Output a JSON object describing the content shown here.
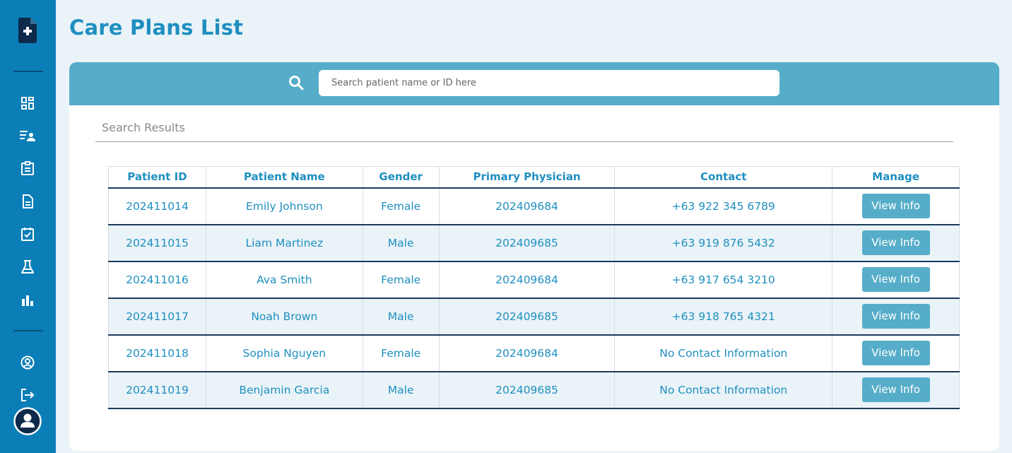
{
  "page": {
    "title": "Care Plans List"
  },
  "search": {
    "placeholder": "Search patient name or ID here",
    "results_label": "Search Results"
  },
  "table": {
    "headers": [
      "Patient ID",
      "Patient Name",
      "Gender",
      "Primary Physician",
      "Contact",
      "Manage"
    ],
    "rows": [
      {
        "id": "202411014",
        "name": "Emily Johnson",
        "gender": "Female",
        "physician": "202409684",
        "contact": "+63 922 345 6789",
        "action": "View Info"
      },
      {
        "id": "202411015",
        "name": "Liam Martinez",
        "gender": "Male",
        "physician": "202409685",
        "contact": "+63 919 876 5432",
        "action": "View Info"
      },
      {
        "id": "202411016",
        "name": "Ava Smith",
        "gender": "Female",
        "physician": "202409684",
        "contact": "+63 917 654 3210",
        "action": "View Info"
      },
      {
        "id": "202411017",
        "name": "Noah Brown",
        "gender": "Male",
        "physician": "202409685",
        "contact": "+63 918 765 4321",
        "action": "View Info"
      },
      {
        "id": "202411018",
        "name": "Sophia Nguyen",
        "gender": "Female",
        "physician": "202409684",
        "contact": "No Contact Information",
        "action": "View Info"
      },
      {
        "id": "202411019",
        "name": "Benjamin Garcia",
        "gender": "Male",
        "physician": "202409685",
        "contact": "No Contact Information",
        "action": "View Info"
      }
    ]
  },
  "sidebar": {
    "icons": [
      "medical-file-plus-icon",
      "dashboard-grid-icon",
      "patient-list-icon",
      "clipboard-icon",
      "document-icon",
      "checklist-icon",
      "lab-flask-icon",
      "bar-chart-icon",
      "user-circle-icon",
      "logout-icon",
      "avatar-icon"
    ]
  },
  "colors": {
    "sidebar": "#0b7eb8",
    "accent": "#56adc9",
    "text_accent": "#1f8fc0",
    "background": "#eaf3f8",
    "row_divider": "#1b3a5a"
  }
}
